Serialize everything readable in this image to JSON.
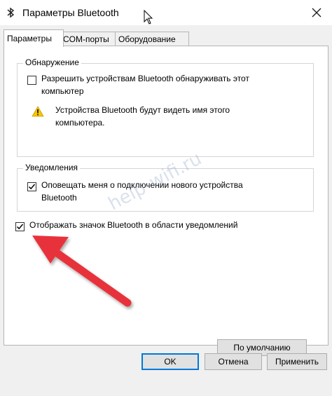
{
  "window": {
    "title": "Параметры Bluetooth"
  },
  "tabs": [
    {
      "label": "Параметры",
      "active": true
    },
    {
      "label": "COM-порты",
      "active": false
    },
    {
      "label": "Оборудование",
      "active": false
    }
  ],
  "discovery": {
    "legend": "Обнаружение",
    "allow_line1": "Разрешить устройствам Bluetooth обнаруживать этот",
    "allow_line2": "компьютер",
    "allow_checked": false,
    "warning_line1": "Устройства Bluetooth будут видеть имя этого",
    "warning_line2": "компьютера."
  },
  "notifications": {
    "legend": "Уведомления",
    "notify_line1": "Оповещать меня о подключении нового устройства",
    "notify_line2": "Bluetooth",
    "notify_checked": true
  },
  "show_icon": {
    "label": "Отображать значок Bluetooth в области уведомлений",
    "checked": true
  },
  "buttons": {
    "defaults": "По умолчанию",
    "ok": "OK",
    "cancel": "Отмена",
    "apply": "Применить"
  },
  "watermark": "help-wifi.ru",
  "colors": {
    "arrow": "#e8313a",
    "accent": "#0078d7",
    "warning": "#f7c600"
  }
}
